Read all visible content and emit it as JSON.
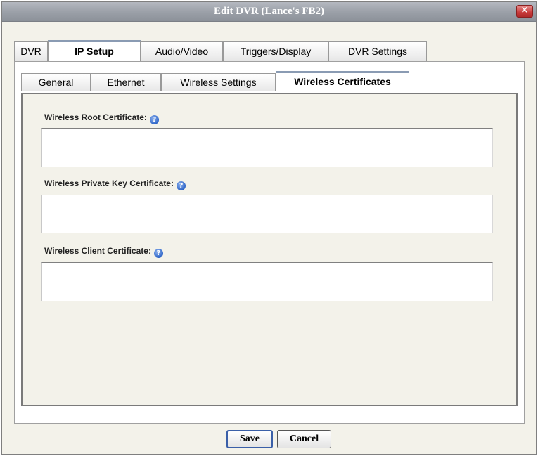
{
  "window": {
    "title": "Edit DVR (Lance's FB2)",
    "close_symbol": "×",
    "close_icon": "close-icon"
  },
  "tabs": [
    {
      "label": "DVR",
      "active": false
    },
    {
      "label": "IP Setup",
      "active": true
    },
    {
      "label": "Audio/Video",
      "active": false
    },
    {
      "label": "Triggers/Display",
      "active": false
    },
    {
      "label": "DVR Settings",
      "active": false
    }
  ],
  "subtabs": [
    {
      "label": "General",
      "active": false
    },
    {
      "label": "Ethernet",
      "active": false
    },
    {
      "label": "Wireless Settings",
      "active": false
    },
    {
      "label": "Wireless Certificates",
      "active": true
    }
  ],
  "fields": {
    "root": {
      "label": "Wireless Root Certificate:",
      "value": ""
    },
    "private_key": {
      "label": "Wireless Private Key Certificate:",
      "value": ""
    },
    "client": {
      "label": "Wireless Client Certificate:",
      "value": ""
    }
  },
  "help_icon": {
    "symbol": "?",
    "icon": "help-icon"
  },
  "buttons": {
    "save": "Save",
    "cancel": "Cancel"
  },
  "colors": {
    "title_bar": "#9ca1a9",
    "close_button": "#c83a3a",
    "help_icon": "#2f66c8",
    "panel_background": "#f3f2ea"
  }
}
